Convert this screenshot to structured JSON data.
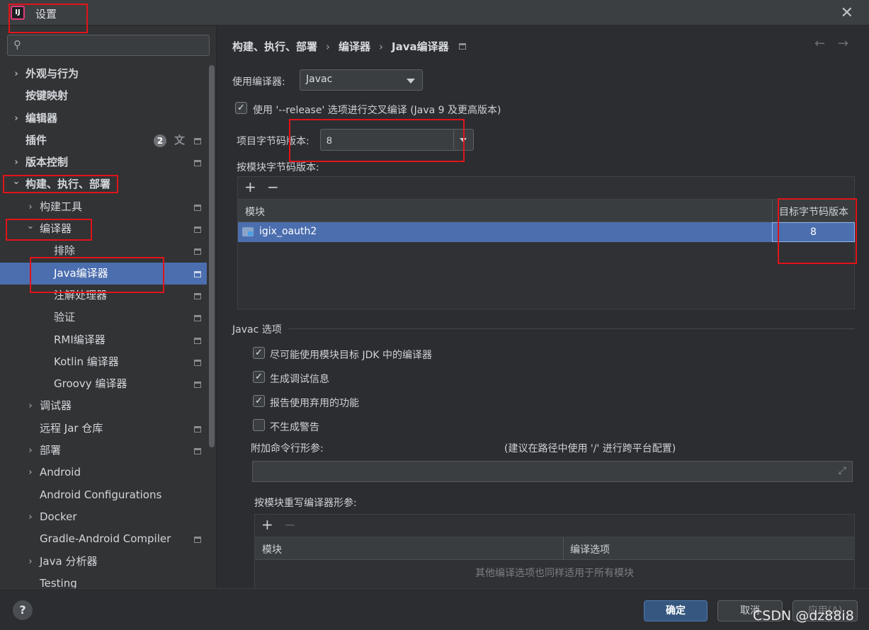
{
  "window": {
    "title": "设置",
    "app_icon_text": "IJ"
  },
  "search": {
    "placeholder": "",
    "icon": "search-icon"
  },
  "sidebar": {
    "items": [
      {
        "label": "外观与行为",
        "level": 0,
        "chevron": "right",
        "bold": true
      },
      {
        "label": "按键映射",
        "level": 0,
        "chevron": "",
        "bold": true
      },
      {
        "label": "编辑器",
        "level": 0,
        "chevron": "right",
        "bold": true
      },
      {
        "label": "插件",
        "level": 0,
        "chevron": "",
        "bold": true,
        "badge": "2"
      },
      {
        "label": "版本控制",
        "level": 0,
        "chevron": "right",
        "bold": true
      },
      {
        "label": "构建、执行、部署",
        "level": 0,
        "chevron": "down",
        "bold": true
      },
      {
        "label": "构建工具",
        "level": 1,
        "chevron": "right"
      },
      {
        "label": "编译器",
        "level": 1,
        "chevron": "down"
      },
      {
        "label": "排除",
        "level": 2,
        "chevron": ""
      },
      {
        "label": "Java编译器",
        "level": 2,
        "chevron": "",
        "selected": true
      },
      {
        "label": "注解处理器",
        "level": 2,
        "chevron": ""
      },
      {
        "label": "验证",
        "level": 2,
        "chevron": ""
      },
      {
        "label": "RMI编译器",
        "level": 2,
        "chevron": ""
      },
      {
        "label": "Kotlin 编译器",
        "level": 2,
        "chevron": ""
      },
      {
        "label": "Groovy 编译器",
        "level": 2,
        "chevron": ""
      },
      {
        "label": "调试器",
        "level": 1,
        "chevron": "right"
      },
      {
        "label": "远程 Jar 仓库",
        "level": 1,
        "chevron": ""
      },
      {
        "label": "部署",
        "level": 1,
        "chevron": "right"
      },
      {
        "label": "Android",
        "level": 1,
        "chevron": "right"
      },
      {
        "label": "Android Configurations",
        "level": 1,
        "chevron": ""
      },
      {
        "label": "Docker",
        "level": 1,
        "chevron": "right"
      },
      {
        "label": "Gradle-Android Compiler",
        "level": 1,
        "chevron": ""
      },
      {
        "label": "Java 分析器",
        "level": 1,
        "chevron": "right"
      },
      {
        "label": "Testing",
        "level": 1,
        "chevron": ""
      }
    ]
  },
  "breadcrumb": {
    "part1": "构建、执行、部署",
    "part2": "编译器",
    "part3": "Java编译器"
  },
  "form": {
    "compiler_label": "使用编译器:",
    "compiler_value": "Javac",
    "release_option_label": "使用 '--release' 选项进行交叉编译 (Java 9 及更高版本)",
    "bytecode_label": "项目字节码版本:",
    "bytecode_value": "8",
    "per_module_label": "按模块字节码版本:"
  },
  "module_table": {
    "col_module": "模块",
    "col_target": "目标字节码版本",
    "rows": [
      {
        "module": "igix_oauth2",
        "target": "8"
      }
    ]
  },
  "javac": {
    "section_title": "Javac 选项",
    "opt1": "尽可能使用模块目标 JDK 中的编译器",
    "opt2": "生成调试信息",
    "opt3": "报告使用弃用的功能",
    "opt4": "不生成警告",
    "extra_args_label": "附加命令行形参:",
    "extra_args_hint": "(建议在路径中使用 '/' 进行跨平台配置)",
    "override_label": "按模块重写编译器形参:",
    "override_col_module": "模块",
    "override_col_options": "编译选项",
    "override_empty": "其他编译选项也同样适用于所有模块"
  },
  "footer": {
    "ok": "确定",
    "cancel": "取消",
    "apply": "应用(A)",
    "watermark": "CSDN @dz88i8"
  },
  "colors": {
    "accent": "#4b6eaf",
    "annotation": "#e0141a"
  }
}
